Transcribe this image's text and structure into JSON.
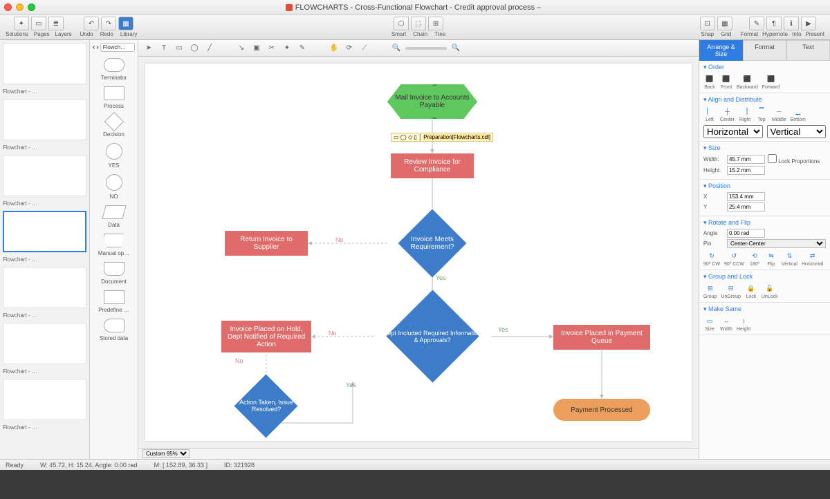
{
  "title": {
    "prefix": "FLOWCHARTS",
    "name": "Cross-Functional Flowchart - Credit approval process"
  },
  "toolbar": {
    "solutions": "Solutions",
    "pages": "Pages",
    "layers": "Layers",
    "undo": "Undo",
    "redo": "Redo",
    "library": "Library",
    "smart": "Smart",
    "chain": "Chain",
    "tree": "Tree",
    "snap": "Snap",
    "grid": "Grid",
    "format": "Format",
    "hypernote": "Hypernote",
    "info": "Info",
    "present": "Present"
  },
  "shapelib": {
    "selector": "Flowch…",
    "items": [
      {
        "label": "Terminator"
      },
      {
        "label": "Process"
      },
      {
        "label": "Decision"
      },
      {
        "label": "YES"
      },
      {
        "label": "NO"
      },
      {
        "label": "Data"
      },
      {
        "label": "Manual op…"
      },
      {
        "label": "Document"
      },
      {
        "label": "Predefine …"
      },
      {
        "label": "Stored data"
      }
    ]
  },
  "thumbs": [
    {
      "label": "Flowchart - …"
    },
    {
      "label": "Flowchart - …"
    },
    {
      "label": "Flowchart - …"
    },
    {
      "label": "Flowchart - …",
      "selected": true
    },
    {
      "label": "Flowchart - …"
    },
    {
      "label": "Flowchart - …"
    },
    {
      "label": "Flowchart - …"
    }
  ],
  "flow": {
    "n1": "Mail Invoice to Accounts Payable",
    "n2": "Review Invoice for Compliance",
    "n3": "Invoice Meets Requirement?",
    "n4": "Return Invoice to Supplier",
    "n5": "Dept Included Required Information & Approvals?",
    "n6": "Invoice Placed on Hold, Dept Notified of Required Action",
    "n7": "Invoice Placed in Payment Queue",
    "n8": "Action Taken, Issue Resolved?",
    "n9": "Payment Processed",
    "yes": "Yes",
    "no": "No",
    "tooltip": "Preparation[Flowcharts.cdl]"
  },
  "canvas_toolbar": {
    "zoom_label": "Custom 95%"
  },
  "right": {
    "tabs": {
      "arrange": "Arrange & Size",
      "format": "Format",
      "text": "Text"
    },
    "order": {
      "title": "Order",
      "back": "Back",
      "front": "Front",
      "backward": "Backward",
      "forward": "Forward"
    },
    "align": {
      "title": "Align and Distribute",
      "left": "Left",
      "center": "Center",
      "right": "Right",
      "top": "Top",
      "middle": "Middle",
      "bottom": "Bottom",
      "horizontal": "Horizontal",
      "vertical": "Vertical"
    },
    "size": {
      "title": "Size",
      "w_label": "Width:",
      "w": "45.7 mm",
      "h_label": "Height:",
      "h": "15.2 mm",
      "lock": "Lock Proportions"
    },
    "position": {
      "title": "Position",
      "x_label": "X",
      "x": "153.4 mm",
      "y_label": "Y",
      "y": "25.4 mm"
    },
    "rotate": {
      "title": "Rotate and Flip",
      "angle_label": "Angle",
      "angle": "0.00 rad",
      "pin_label": "Pin",
      "pin": "Center-Center",
      "cw": "90º CW",
      "ccw": "90º CCW",
      "r180": "180º",
      "flip": "Flip",
      "v": "Vertical",
      "h": "Horizontal"
    },
    "group": {
      "title": "Group and Lock",
      "group": "Group",
      "ungroup": "UnGroup",
      "lock": "Lock",
      "unlock": "UnLock"
    },
    "make": {
      "title": "Make Same",
      "size": "Size",
      "width": "Width",
      "height": "Height"
    }
  },
  "status": {
    "ready": "Ready",
    "dims": "W: 45.72,  H: 15.24,  Angle: 0.00 rad",
    "m": "M: [ 152.89, 36.33 ]",
    "id": "ID: 321928"
  }
}
